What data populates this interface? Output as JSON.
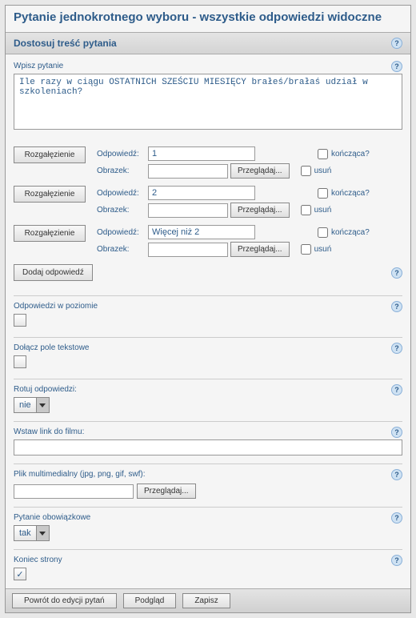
{
  "page_title": "Pytanie jednokrotnego wyboru - wszystkie odpowiedzi widoczne",
  "section_title": "Dostosuj treść pytania",
  "question_label": "Wpisz pytanie",
  "question_text": "Ile razy w ciągu OSTATNICH SZEŚCIU MIESIĘCY brałeś/brałaś udział w szkoleniach?",
  "branch_label": "Rozgałęzienie",
  "answer_label": "Odpowiedź:",
  "image_label": "Obrazek:",
  "browse_label": "Przeglądaj...",
  "ending_label": "kończąca?",
  "delete_label": "usuń",
  "answers": [
    {
      "value": "1",
      "ending": false,
      "del": false
    },
    {
      "value": "2",
      "ending": false,
      "del": false
    },
    {
      "value": "Więcej niż 2",
      "ending": false,
      "del": false
    }
  ],
  "add_answer_label": "Dodaj odpowiedź",
  "horizontal_label": "Odpowiedzi w poziomie",
  "horizontal_checked": false,
  "textfield_label": "Dołącz pole tekstowe",
  "textfield_checked": false,
  "rotate_label": "Rotuj odpowiedzi:",
  "rotate_value": "nie",
  "movie_label": "Wstaw link do filmu:",
  "movie_value": "",
  "media_label": "Plik multimedialny (jpg, png, gif, swf):",
  "media_value": "",
  "required_label": "Pytanie obowiązkowe",
  "required_value": "tak",
  "endpage_label": "Koniec strony",
  "endpage_checked": true,
  "btn_back": "Powrót do edycji pytań",
  "btn_preview": "Podgląd",
  "btn_save": "Zapisz"
}
